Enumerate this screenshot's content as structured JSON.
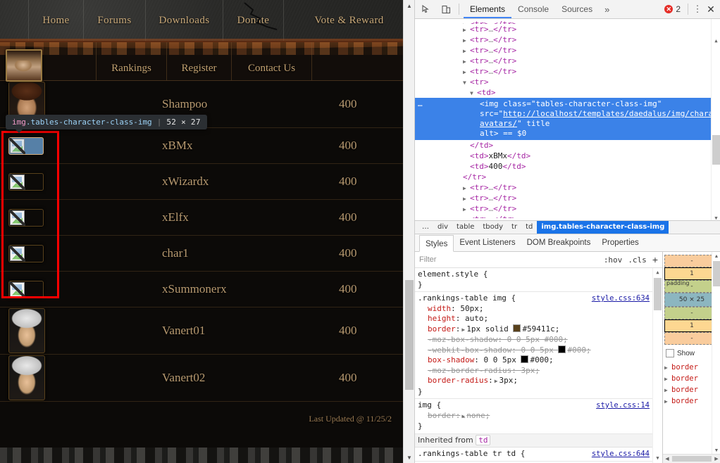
{
  "page": {
    "nav_primary": [
      "Home",
      "Forums",
      "Downloads",
      "Donate",
      "Vote & Reward"
    ],
    "nav_secondary": [
      "Rankings",
      "Register",
      "Contact Us"
    ],
    "table": {
      "rows": [
        {
          "name": "Shampoo",
          "value": "400",
          "avatar": "face-a"
        },
        {
          "name": "xBMx",
          "value": "400",
          "avatar": "broken-hover"
        },
        {
          "name": "xWizardx",
          "value": "400",
          "avatar": "broken"
        },
        {
          "name": "xElfx",
          "value": "400",
          "avatar": "broken"
        },
        {
          "name": "char1",
          "value": "400",
          "avatar": "broken"
        },
        {
          "name": "xSummonerx",
          "value": "400",
          "avatar": "broken"
        },
        {
          "name": "Vanert01",
          "value": "400",
          "avatar": "face-b"
        },
        {
          "name": "Vanert02",
          "value": "400",
          "avatar": "face-b"
        }
      ]
    },
    "last_updated": "Last Updated @ 11/25/2",
    "inspect_tooltip": {
      "tag": "img",
      "class": ".tables-character-class-img",
      "separator": "|",
      "dimensions": "52 × 27"
    }
  },
  "devtools": {
    "toolbar": {
      "inspect_icon": "inspect-cursor-icon",
      "device_icon": "device-toolbar-icon",
      "tabs": [
        "Elements",
        "Console",
        "Sources"
      ],
      "active_tab": "Elements",
      "more_tabs": "»",
      "error_count": "2",
      "error_glyph": "✕",
      "kebab": "⋮",
      "close": "✕"
    },
    "dom": {
      "rows": [
        {
          "indent": 5,
          "twisty": "closed",
          "text": "<tr>…</tr>",
          "kind": "collapsed",
          "clipped": true
        },
        {
          "indent": 5,
          "twisty": "closed",
          "text": "<tr>…</tr>",
          "kind": "collapsed"
        },
        {
          "indent": 5,
          "twisty": "closed",
          "text": "<tr>…</tr>",
          "kind": "collapsed"
        },
        {
          "indent": 5,
          "twisty": "closed",
          "text": "<tr>…</tr>",
          "kind": "collapsed"
        },
        {
          "indent": 5,
          "twisty": "closed",
          "text": "<tr>…</tr>",
          "kind": "collapsed"
        },
        {
          "indent": 5,
          "twisty": "closed",
          "text": "<tr>…</tr>",
          "kind": "collapsed"
        },
        {
          "indent": 5,
          "twisty": "open",
          "text": "<tr>",
          "kind": "open"
        },
        {
          "indent": 6,
          "twisty": "open",
          "text": "<td>",
          "kind": "open"
        }
      ],
      "selected": {
        "leading_dots": "…",
        "segments": [
          {
            "t": "<img ",
            "c": "tag"
          },
          {
            "t": "class",
            "c": "attr"
          },
          {
            "t": "=",
            "c": "punc"
          },
          {
            "t": "\"tables-character-class-img\"",
            "c": "val"
          },
          {
            "t": " src",
            "c": "attr"
          },
          {
            "t": "=",
            "c": "punc"
          },
          {
            "t": "\"http://localhost/templates/daedalus/img/character-avatars/\"",
            "c": "val"
          },
          {
            "t": " title",
            "c": "attr"
          },
          {
            "t": " alt",
            "c": "attr"
          },
          {
            "t": ">",
            "c": "tag"
          },
          {
            "t": " == $0",
            "c": "punc"
          }
        ],
        "src_text": "http://localhost/templates/daedalus/img/character-avatars/",
        "class_text": "tables-character-class-img",
        "suffix": "== $0"
      },
      "rows_after": [
        {
          "indent": 6,
          "text": "</td>"
        },
        {
          "indent": 6,
          "text": "<td>xBMx</td>",
          "content": "xBMx"
        },
        {
          "indent": 6,
          "text": "<td>400</td>",
          "content": "400"
        },
        {
          "indent": 5,
          "text": "</tr>"
        },
        {
          "indent": 5,
          "twisty": "closed",
          "text": "<tr>…</tr>"
        },
        {
          "indent": 5,
          "twisty": "closed",
          "text": "<tr>…</tr>"
        },
        {
          "indent": 5,
          "twisty": "closed",
          "text": "<tr>…</tr>"
        },
        {
          "indent": 5,
          "twisty": "closed",
          "text": "<tr>…</tr>"
        }
      ]
    },
    "breadcrumb": [
      "…",
      "div",
      "table",
      "tbody",
      "tr",
      "td",
      "img.tables-character-class-img"
    ],
    "breadcrumb_active": "img.tables-character-class-img",
    "styles_tabs": [
      "Styles",
      "Event Listeners",
      "DOM Breakpoints",
      "Properties"
    ],
    "styles_active_tab": "Styles",
    "filter": {
      "placeholder": "Filter",
      "hov": ":hov",
      "cls": ".cls",
      "plus": "+"
    },
    "css_rules": [
      {
        "selector": "element.style {",
        "source": "",
        "close": "}",
        "props": []
      },
      {
        "selector": ".rankings-table img {",
        "source": "style.css:634",
        "close": "}",
        "props": [
          {
            "name": "width",
            "value": "50px",
            "state": "active"
          },
          {
            "name": "height",
            "value": "auto",
            "state": "active"
          },
          {
            "name": "border",
            "value": "1px solid #59411c",
            "state": "active",
            "expandable": true,
            "swatch": "#59411c"
          },
          {
            "name": "-moz-box-shadow",
            "value": "0 0 5px #000",
            "state": "struck"
          },
          {
            "name": "-webkit-box-shadow",
            "value": "0 0 5px #000",
            "state": "struck",
            "swatch": "#000000"
          },
          {
            "name": "box-shadow",
            "value": "0 0 5px #000",
            "state": "active",
            "swatch": "#000000"
          },
          {
            "name": "-moz-border-radius",
            "value": "3px",
            "state": "struck"
          },
          {
            "name": "border-radius",
            "value": "3px",
            "state": "active",
            "expandable": true
          }
        ]
      },
      {
        "selector": "img {",
        "source": "style.css:14",
        "close": "}",
        "props": [
          {
            "name": "border",
            "value": "none",
            "state": "struck",
            "expandable": true
          }
        ]
      }
    ],
    "inherited": {
      "label": "Inherited from",
      "tag": "td"
    },
    "inherited_rule": {
      "selector": ".rankings-table tr td {",
      "source": "style.css:644"
    },
    "box_model": {
      "margin_top": "-",
      "border_top": "1",
      "padding_label": "padding",
      "padding_top": "-",
      "content": "50 × 25",
      "padding_bottom": "-",
      "border_bottom": "1",
      "margin_bottom": "-"
    },
    "computed": {
      "show_all_label": "Show",
      "properties": [
        "border",
        "border",
        "border",
        "border"
      ]
    }
  }
}
